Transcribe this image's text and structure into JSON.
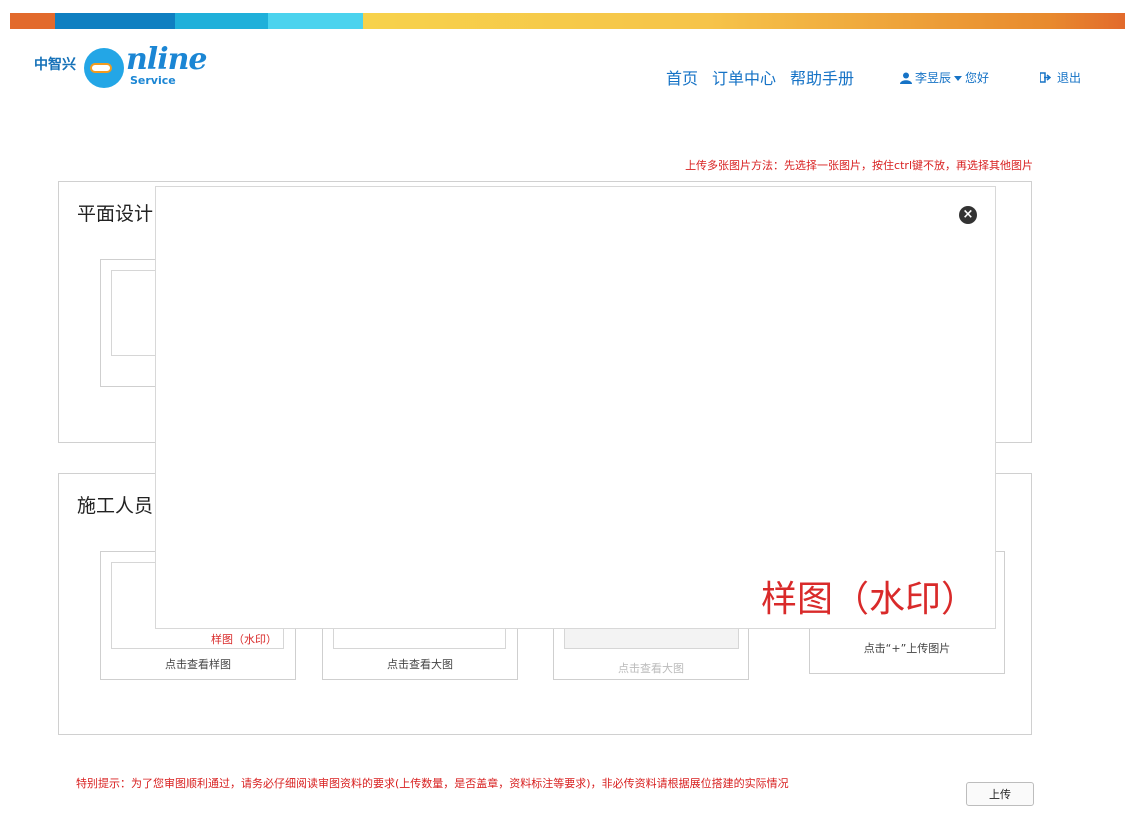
{
  "colors": {
    "topbar": [
      "#e26a2c",
      "#0f7fc1",
      "#1fb0da",
      "#4bd3ee",
      "#f7d24b",
      "#e88a2e"
    ],
    "accent": "#1673c6",
    "warning": "#d82020"
  },
  "logo": {
    "cn": "中智兴",
    "word": "nline",
    "service": "Service"
  },
  "nav": {
    "home": "首页",
    "orders": "订单中心",
    "help": "帮助手册"
  },
  "user": {
    "name": "李昱辰",
    "greeting": "您好",
    "icon": "user-icon",
    "caret_icon": "caret-down-icon"
  },
  "logout": {
    "label": "退出",
    "icon": "logout-icon"
  },
  "tips": {
    "top": "上传多张图片方法：先选择一张图片，按住ctrl键不放，再选择其他图片",
    "bottom": "特别提示：为了您审图顺利通过，请务必仔细阅读审图资料的要求(上传数量，是否盖章，资料标注等要求)，非必传资料请根据展位搭建的实际情况"
  },
  "section1": {
    "title": "平面设计"
  },
  "section2": {
    "title": "施工人员",
    "cards": [
      {
        "caption": "点击查看样图",
        "watermark": "样图（水印）"
      },
      {
        "caption": "点击查看大图"
      },
      {
        "caption": "点击查看大图"
      },
      {
        "caption": "点击“+”上传图片"
      }
    ]
  },
  "modal": {
    "watermark": "样图（水印）",
    "close_icon": "close-circle-icon"
  },
  "upload_button": "上传"
}
